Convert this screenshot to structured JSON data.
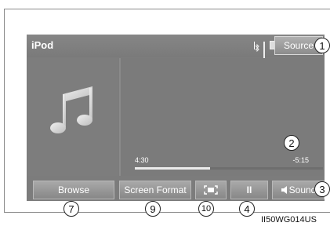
{
  "app": {
    "title": "iPod",
    "source_label": "Source"
  },
  "status": {
    "icons": [
      "bluetooth-icon",
      "signal-bars-icon",
      "battery-icon"
    ]
  },
  "playback": {
    "elapsed": "4:30",
    "remaining": "-5:15",
    "progress_fraction": 0.4
  },
  "buttons": {
    "browse": "Browse",
    "screen_format": "Screen Format",
    "pause": "II",
    "sound": "Sound"
  },
  "callouts": [
    "1",
    "2",
    "3",
    "4",
    "7",
    "9",
    "10"
  ],
  "figure_code": "II50WG014US",
  "colors": {
    "screen_bg": "#7c7c7c",
    "button_bg": "#999999",
    "text": "#ffffff"
  }
}
